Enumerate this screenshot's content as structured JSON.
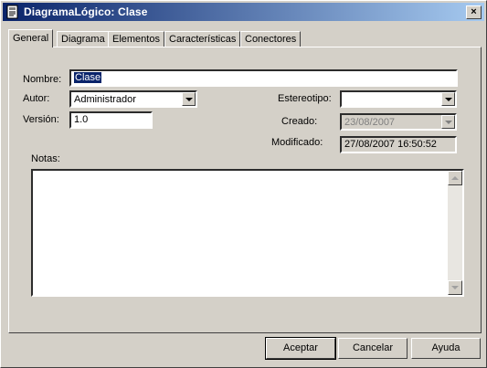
{
  "window": {
    "title": "DiagramaLógico: Clase",
    "close_label": "×"
  },
  "tabs": [
    {
      "label": "General",
      "active": true
    },
    {
      "label": "Diagrama",
      "active": false
    },
    {
      "label": "Elementos",
      "active": false
    },
    {
      "label": "Características",
      "active": false
    },
    {
      "label": "Conectores",
      "active": false
    }
  ],
  "form": {
    "nombre_label": "Nombre:",
    "nombre_value": "Clase",
    "autor_label": "Autor:",
    "autor_value": "Administrador",
    "version_label": "Versión:",
    "version_value": "1.0",
    "estereotipo_label": "Estereotipo:",
    "estereotipo_value": "",
    "creado_label": "Creado:",
    "creado_value": "23/08/2007",
    "modificado_label": "Modificado:",
    "modificado_value": "27/08/2007 16:50:52",
    "notas_label": "Notas:",
    "notas_value": ""
  },
  "buttons": {
    "ok": "Aceptar",
    "cancel": "Cancelar",
    "help": "Ayuda"
  },
  "colors": {
    "titlebar_start": "#0a246a",
    "titlebar_end": "#a6caf0",
    "face": "#d4d0c8",
    "selection": "#0a246a"
  },
  "icons": {
    "window": "document-icon",
    "close": "close-icon",
    "dropdown": "chevron-down-icon"
  }
}
